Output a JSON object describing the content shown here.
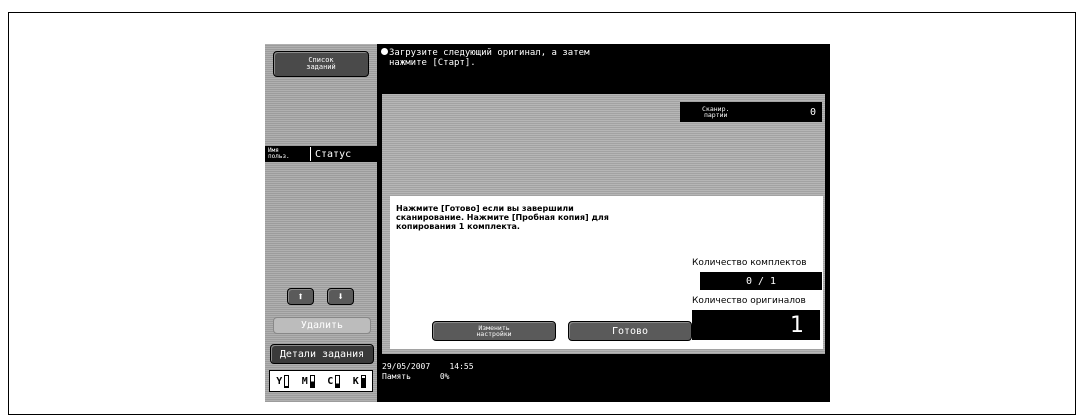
{
  "left": {
    "job_list_label_1": "Список",
    "job_list_label_2": "заданий",
    "col_user_1": "Имя",
    "col_user_2": "польз.",
    "col_status": "Статус",
    "arrow_up": "⬆",
    "arrow_down": "⬇",
    "delete_label": "Удалить",
    "details_label": "Детали задания",
    "toner": [
      {
        "letter": "Y",
        "level": 0.1
      },
      {
        "letter": "M",
        "level": 0.5
      },
      {
        "letter": "C",
        "level": 0.3
      },
      {
        "letter": "K",
        "level": 0.8
      }
    ]
  },
  "message": {
    "line1": "Загрузите следующий оригинал, а затем",
    "line2": "нажмите [Старт]."
  },
  "main": {
    "scan_batches_label_1": "Сканир.",
    "scan_batches_label_2": "партии",
    "scan_batches_value": "0",
    "instruction_line1": "Нажмите [Готово] если вы завершили",
    "instruction_line2": "сканирование. Нажмите [Пробная копия] для",
    "instruction_line3": "копирования 1 комплекта.",
    "sets_label": "Количество комплектов",
    "sets_value": "0 / 1",
    "originals_label": "Количество оригиналов",
    "originals_value": "1",
    "change_settings_1": "Изменить",
    "change_settings_2": "настройки",
    "done_label": "Готово"
  },
  "footer": {
    "date": "29/05/2007",
    "time": "14:55",
    "memory_label": "Память",
    "memory_value": "0%"
  }
}
